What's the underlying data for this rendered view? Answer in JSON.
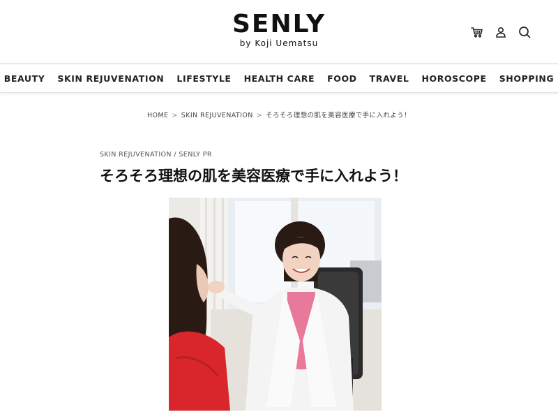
{
  "site": {
    "logo_main": "SENLY",
    "logo_sub": "by Koji Uematsu"
  },
  "header_icons": [
    "cart-icon",
    "user-icon",
    "search-icon"
  ],
  "nav": {
    "items": [
      {
        "label": "BEAUTY"
      },
      {
        "label": "SKIN REJUVENATION"
      },
      {
        "label": "LIFESTYLE"
      },
      {
        "label": "HEALTH CARE"
      },
      {
        "label": "FOOD"
      },
      {
        "label": "TRAVEL"
      },
      {
        "label": "HOROSCOPE"
      },
      {
        "label": "SHOPPING"
      }
    ]
  },
  "breadcrumb": {
    "home": "HOME",
    "category": "SKIN REJUVENATION",
    "current": "そろそろ理想の肌を美容医療で手に入れよう！",
    "separator": ">"
  },
  "article": {
    "category_primary": "SKIN REJUVENATION",
    "category_divider": " / ",
    "category_secondary": "SENLY PR",
    "title": "そろそろ理想の肌を美容医療で手に入れよう！"
  },
  "colors": {
    "text": "#111111",
    "border": "#cfcfcf",
    "coat": "#f4f4f4",
    "scrub": "#e8799a",
    "patient_top": "#d9262c",
    "hair": "#2a1a14"
  }
}
